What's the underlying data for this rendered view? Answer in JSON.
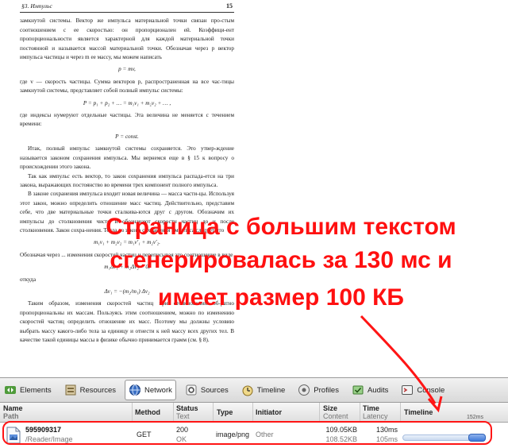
{
  "document": {
    "header_left": "§3. Импульс",
    "header_right": "15",
    "paragraphs": [
      "замкнутой системы. Вектор же импульса материальной точки связан про-стым соотношением с ее скоростью: он пропорционален ей. Коэффици-ент пропорциональности является характерной для каждой материальной точки постоянной и называется массой материальной точки. Обозначая через p вектор импульса частицы и через m ее массу, мы можем написать",
      "p = mv,",
      "где v — скорость частицы. Сумма векторов p, распространенная на все час-тицы замкнутой системы, представляет собой полный импульс системы:",
      "P = p₁ + p₂ + … = m₁v₁ + m₂v₂ + … ,",
      "где индексы нумеруют отдельные частицы. Эта величина не меняется с течением времени:",
      "P = const.",
      "Итак, полный импульс замкнутой системы сохраняется. Это утвер-ждение называется законом сохранения импульса. Мы вернемся еще в § 15 к вопросу о происхождении этого закона.",
      "Так как импульс есть вектор, то закон сохранения импульса распада-ется на три закона, выражающих постоянство во времени трех компонент полного импульса.",
      "В законе сохранения импульса входит новая величина — масса части-цы. Используя этот закон, можно определить отношение масс частиц. Действительно, представим себе, что две материальные точки сталкива-ются друг с другом. Обозначим их импульсы до столкновения чисто и обозначают скорости частиц до и после столкновения. Закон сохра-нения. Тогда из закона сохранения импульса следует что",
      "m₁v₁ + m₂v₂ = m₁v′₁ + m₂v′₂.",
      "Обозначая через ... изменения скоростей частиц и переписывая это соотношение в виде",
      "m₁Δv₁ + m₂Δv₂ = 0,",
      "откуда",
      "Δv₁ = −(m₂/m₁) Δv₂",
      "Таким образом, изменения скоростей частиц при столкновении об-ратно пропорциональны их массам. Пользуясь этим соотношением, можно по изменению скоростей частиц определить отношение их масс. Поэтому мы должны условию выбрать массу какого-либо тела за единицу и отнести к ней массу всех других тел. В качестве такой единицы массы в физике обычно принимается грамм (см. § 8)."
    ]
  },
  "annotation": {
    "line1": "Страница с большим текстом",
    "line2": "сгенерировалась за 130 мс и",
    "line3": "имеет размер 100 КБ",
    "color": "#ff1010"
  },
  "devtools": {
    "tabs": [
      {
        "label": "Elements",
        "icon": "elements-icon",
        "selected": false
      },
      {
        "label": "Resources",
        "icon": "resources-icon",
        "selected": false
      },
      {
        "label": "Network",
        "icon": "network-icon",
        "selected": true
      },
      {
        "label": "Sources",
        "icon": "sources-icon",
        "selected": false
      },
      {
        "label": "Timeline",
        "icon": "timeline-icon",
        "selected": false
      },
      {
        "label": "Profiles",
        "icon": "profiles-icon",
        "selected": false
      },
      {
        "label": "Audits",
        "icon": "audits-icon",
        "selected": false
      },
      {
        "label": "Console",
        "icon": "console-icon",
        "selected": false
      }
    ],
    "columns": {
      "name": "Name",
      "path": "Path",
      "method": "Method",
      "status": "Status",
      "status_sub": "Text",
      "type": "Type",
      "initiator": "Initiator",
      "size": "Size",
      "size_sub": "Content",
      "time": "Time",
      "time_sub": "Latency",
      "timeline": "Timeline",
      "timeline_tick": "152ms"
    },
    "rows": [
      {
        "name": "595909317",
        "path": "/Reader/Image",
        "method": "GET",
        "status": "200",
        "status_text": "OK",
        "type": "image/png",
        "initiator": "Other",
        "size": "109.05KB",
        "content": "108.52KB",
        "time": "130ms",
        "latency": "105ms",
        "wait_fraction": 0.69,
        "total_fraction": 0.86
      }
    ]
  }
}
